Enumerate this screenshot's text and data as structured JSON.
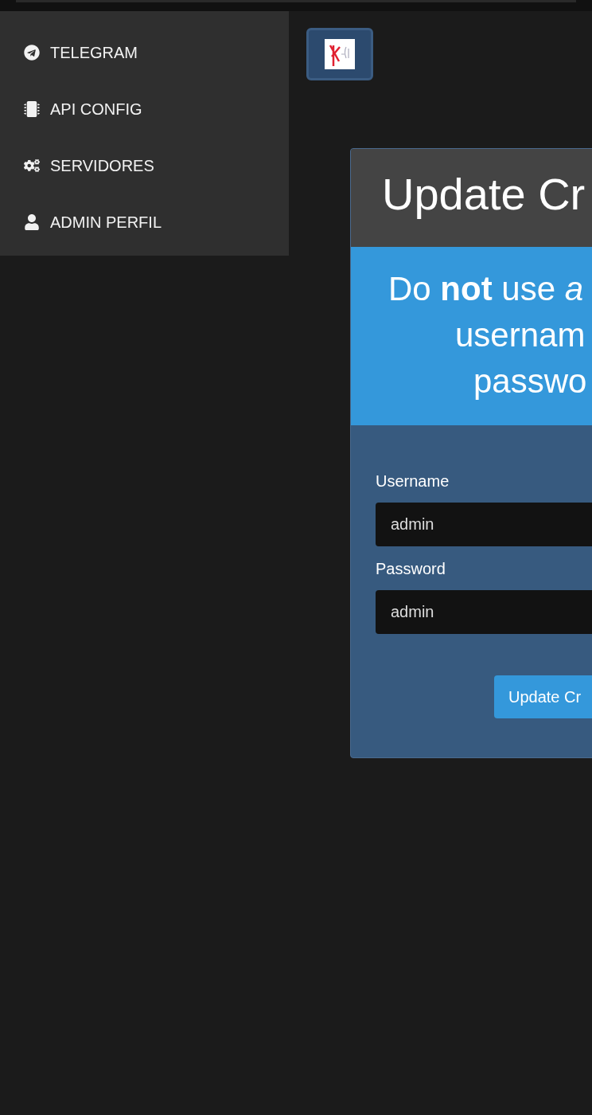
{
  "sidebar": {
    "items": [
      {
        "label": "TELEGRAM",
        "kind": "telegram"
      },
      {
        "label": "API CONFIG",
        "kind": "chip"
      },
      {
        "label": "SERVIDORES",
        "kind": "cogs"
      },
      {
        "label": "ADMIN PERFIL",
        "kind": "user"
      }
    ]
  },
  "card": {
    "title": "Update Cr",
    "alert": {
      "lines": [
        "Do **not** use *a*",
        "usernam",
        "passwo"
      ]
    },
    "fields": [
      {
        "label": "Username",
        "value": "admin"
      },
      {
        "label": "Password",
        "value": "admin"
      }
    ],
    "button": "Update Cr"
  }
}
